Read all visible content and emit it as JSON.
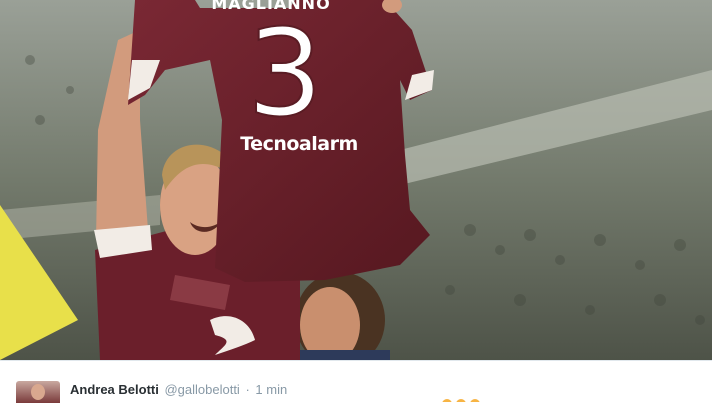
{
  "photo": {
    "jersey_name": "MAGLIANNO",
    "jersey_number": "3",
    "sponsor": "Tecnoalarm",
    "colors": {
      "jersey": "#6b1f2b",
      "stadium": "#6f7468",
      "flag": "#e8e04a"
    }
  },
  "tweet": {
    "display_name": "Andrea Belotti",
    "handle": "@gallobelotti",
    "separator": "·",
    "time": "1 min",
    "avatar_icon": "user-avatar"
  }
}
